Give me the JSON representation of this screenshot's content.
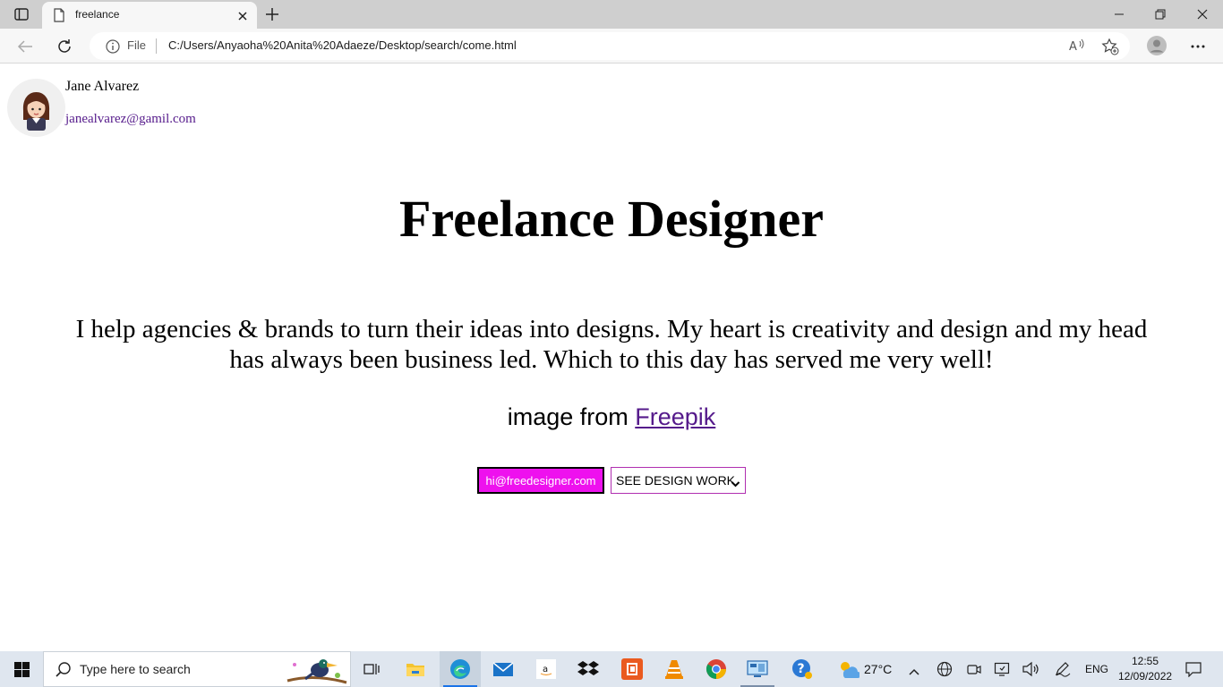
{
  "browser": {
    "tab_title": "freelance",
    "address_scheme_label": "File",
    "address_url": "C:/Users/Anyaoha%20Anita%20Adaeze/Desktop/search/come.html"
  },
  "profile": {
    "name": "Jane Alvarez",
    "email": "janealvarez@gamil.com"
  },
  "main": {
    "headline": "Freelance Designer",
    "intro": "I help agencies & brands to turn their ideas into designs. My heart is creativity and design and my head has always been business led. Which to this day has served me very well!",
    "credit_prefix": "image from ",
    "credit_link": "Freepik",
    "email_button": "hi@freedesigner.com",
    "work_select_value": "SEE DESIGN WORK"
  },
  "taskbar": {
    "search_placeholder": "Type here to search",
    "weather": "27°C",
    "language": "ENG",
    "time": "12:55",
    "date": "12/09/2022"
  },
  "colors": {
    "email_button_bg": "#ee11ee",
    "link": "#551a8b",
    "taskbar_bg": "#dfe6ef",
    "tabbar_bg": "#cfcfcf"
  }
}
